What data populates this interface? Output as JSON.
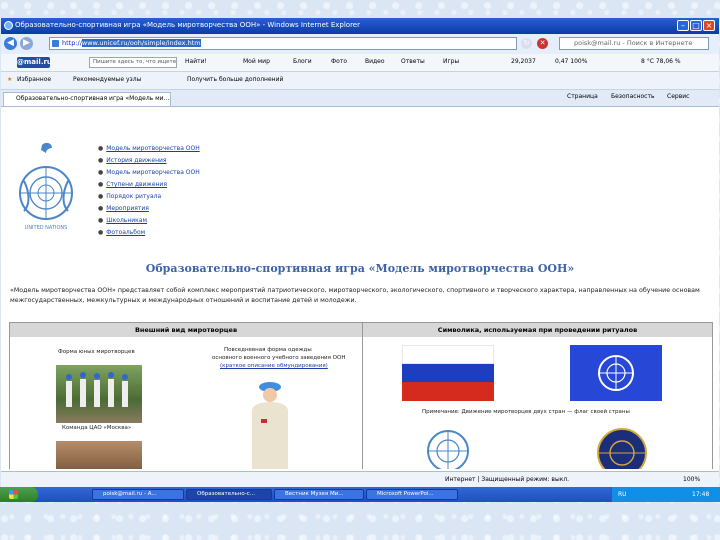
{
  "window": {
    "title": "Образовательно-спортивная игра «Модель миротворчества ООН» - Windows Internet Explorer"
  },
  "address": {
    "url_prefix": "http://",
    "url_selected": "www.unicef.ru/ooh/simple/index.htm"
  },
  "search": {
    "placeholder": "poisk@mail.ru - Поиск в Интернете"
  },
  "toolbar": {
    "logo": "@mail.ru",
    "search_placeholder": "Пишите здесь то, что ищете",
    "items": [
      "Найти!",
      "Мой мир",
      "Блоги",
      "Фото",
      "Видео",
      "Ответы",
      "Игры"
    ],
    "weather": "8 °C 78,06 %",
    "rate": "29,2037",
    "rate2": "0,47 100%"
  },
  "favorites": {
    "label": "Избранное",
    "items": [
      "Рекомендуемые узлы",
      "Получить больше дополнений"
    ]
  },
  "tab": {
    "title": "Образовательно-спортивная игра «Модель ми..."
  },
  "cmdbar": {
    "items": [
      "Страница",
      "Безопасность",
      "Сервис"
    ]
  },
  "logo": {
    "caption": "UNITED NATIONS"
  },
  "menu": [
    "Модель миротворчества ООН",
    "История движения",
    "Модель миротворчества ООН",
    "Ступени движения",
    "Порядок ритуала",
    "Мероприятия",
    "Школьникам",
    "Фотоальбом"
  ],
  "page": {
    "title": "Образовательно-спортивная игра «Модель миротворчества ООН»",
    "intro": "«Модель миротворчества ООН» представляет собой комплекс мероприятий патриотического, миротворческого, экологического, спортивного и творческого характера, направленных на обучение основам межгосударственных, межкультурных и международных отношений и воспитание детей и молодежи."
  },
  "table": {
    "left_header": "Внешний вид миротворцев",
    "right_header": "Символика, используемая при проведении ритуалов",
    "form_title": "Форма юных миротворцев",
    "school_caption": "Команда ЦАО «Москва»",
    "uniform_title": "Повседневная форма одежды",
    "uniform_sub": "основного военного учебного заведения ООН",
    "uniform_link": "(краткое описание обмундирования)",
    "note": "Примечание: Движение миротворцев двух стран — флаг своей страны"
  },
  "statusbar": {
    "text": "Интернет | Защищенный режим: выкл.",
    "zoom": "100%"
  },
  "taskbar": {
    "items": [
      "poisk@mail.ru - A...",
      "Образовательно-с...",
      "Вестник Музея Ми...",
      "Microsoft PowerPoi..."
    ],
    "lang": "RU",
    "time": "17:48"
  }
}
